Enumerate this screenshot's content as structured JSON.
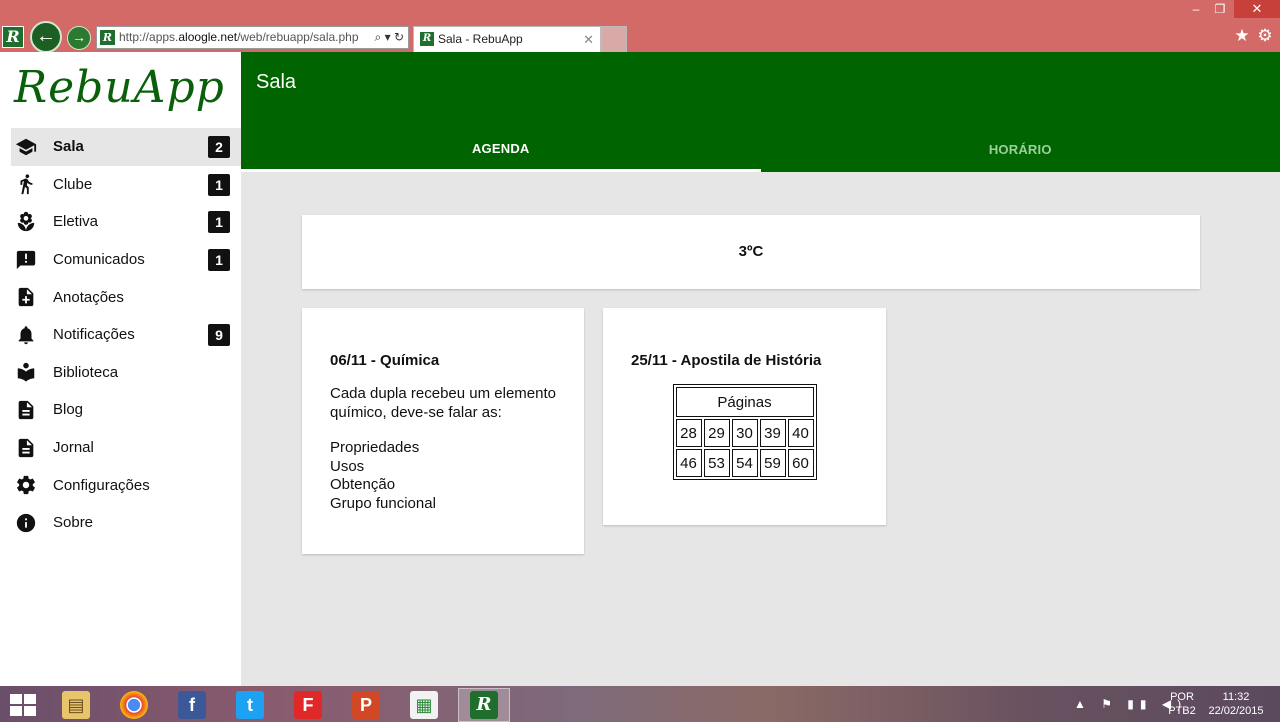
{
  "browser": {
    "url_prefix": "http://apps.",
    "url_host": "aloogle.net",
    "url_path": "/web/rebuapp/sala.php",
    "tab_title": "Sala - RebuApp",
    "favicon_letter": "R"
  },
  "app": {
    "logo": "RebuApp",
    "page_title": "Sala",
    "tabs": [
      {
        "label": "AGENDA",
        "active": true
      },
      {
        "label": "HORÁRIO",
        "active": false
      }
    ]
  },
  "sidebar": {
    "items": [
      {
        "label": "Sala",
        "icon": "school-icon",
        "badge": "2",
        "active": true
      },
      {
        "label": "Clube",
        "icon": "walk-icon",
        "badge": "1"
      },
      {
        "label": "Eletiva",
        "icon": "flower-icon",
        "badge": "1"
      },
      {
        "label": "Comunicados",
        "icon": "announcement-icon",
        "badge": "1"
      },
      {
        "label": "Anotações",
        "icon": "note-add-icon"
      },
      {
        "label": "Notificações",
        "icon": "bell-icon",
        "badge": "9"
      },
      {
        "label": "Biblioteca",
        "icon": "book-reader-icon"
      },
      {
        "label": "Blog",
        "icon": "document-icon"
      },
      {
        "label": "Jornal",
        "icon": "newspaper-icon"
      },
      {
        "label": "Configurações",
        "icon": "gear-icon"
      },
      {
        "label": "Sobre",
        "icon": "info-icon"
      }
    ]
  },
  "weather": {
    "text": "3ºC"
  },
  "cards": [
    {
      "title": "06/11 - Química",
      "text": "Cada dupla recebeu um elemento químico, deve-se falar as:",
      "list": [
        "Propriedades",
        "Usos",
        "Obtenção",
        "Grupo funcional"
      ]
    },
    {
      "title": "25/11 - Apostila de História",
      "table_header": "Páginas",
      "table_rows": [
        [
          "28",
          "29",
          "30",
          "39",
          "40"
        ],
        [
          "46",
          "53",
          "54",
          "59",
          "60"
        ]
      ]
    }
  ],
  "taskbar": {
    "apps": [
      "file-explorer-icon",
      "chrome-icon",
      "facebook-icon",
      "twitter-icon",
      "flipboard-icon",
      "powerpoint-icon",
      "sheets-icon",
      "rebuapp-icon"
    ],
    "lang_line1": "POR",
    "lang_line2": "PTB2",
    "time": "11:32",
    "date": "22/02/2015"
  },
  "colors": {
    "brand_green": "#006400",
    "titlebar": "#d36a68",
    "close_button": "#c7403a"
  }
}
